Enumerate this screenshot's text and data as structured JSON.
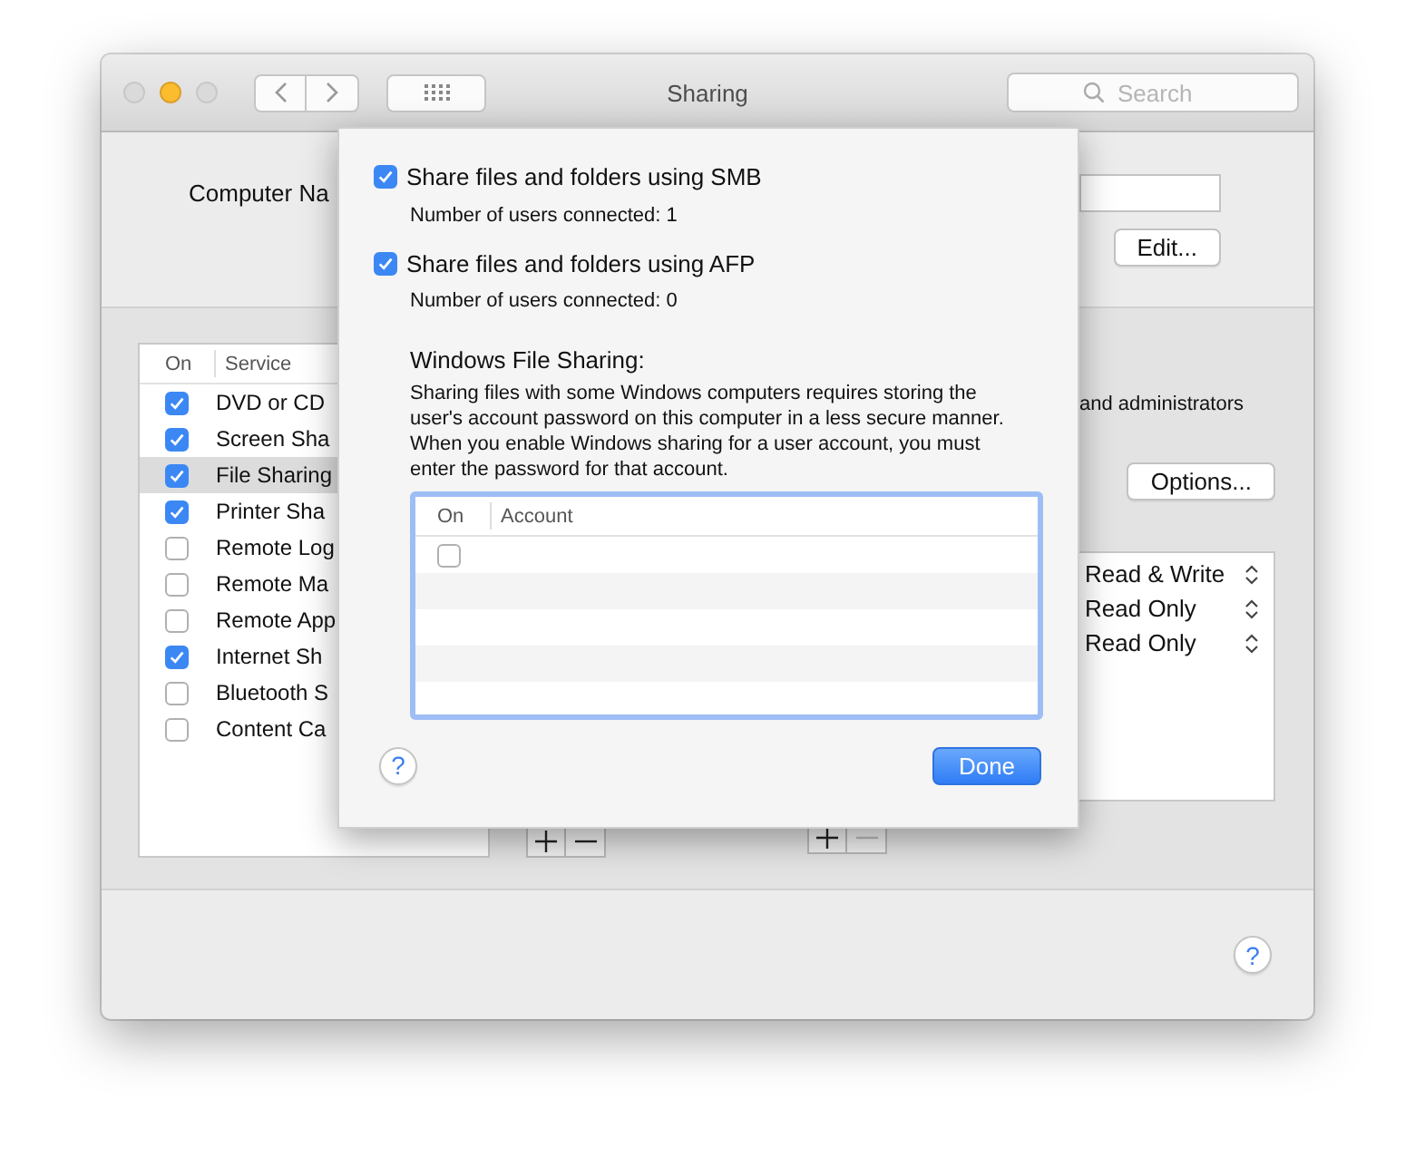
{
  "window": {
    "title": "Sharing"
  },
  "search": {
    "placeholder": "Search"
  },
  "computer_name": {
    "label": "Computer Na"
  },
  "edit_button": "Edit...",
  "services": {
    "columns": [
      "On",
      "Service"
    ],
    "rows": [
      {
        "name": "DVD or CD",
        "checked": true,
        "selected": false
      },
      {
        "name": "Screen Sha",
        "checked": true,
        "selected": false
      },
      {
        "name": "File Sharing",
        "checked": true,
        "selected": true
      },
      {
        "name": "Printer Sha",
        "checked": true,
        "selected": false
      },
      {
        "name": "Remote Log",
        "checked": false,
        "selected": false
      },
      {
        "name": "Remote Ma",
        "checked": false,
        "selected": false
      },
      {
        "name": "Remote App",
        "checked": false,
        "selected": false
      },
      {
        "name": "Internet Sh",
        "checked": true,
        "selected": false
      },
      {
        "name": "Bluetooth S",
        "checked": false,
        "selected": false
      },
      {
        "name": "Content Ca",
        "checked": false,
        "selected": false
      }
    ]
  },
  "shared_folders_controls": {
    "minus_disabled": false
  },
  "access_note": "and administrators",
  "options_button": "Options...",
  "permissions": [
    {
      "value": "Read & Write"
    },
    {
      "value": "Read Only"
    },
    {
      "value": "Read Only"
    }
  ],
  "users_controls": {
    "minus_disabled": true
  },
  "help_button": "?",
  "sheet": {
    "options": [
      {
        "label": "Share files and folders using SMB",
        "checked": true,
        "status": "Number of users connected: 1"
      },
      {
        "label": "Share files and folders using AFP",
        "checked": true,
        "status": "Number of users connected: 0"
      }
    ],
    "windows_heading": "Windows File Sharing:",
    "windows_note": "Sharing files with some Windows computers requires storing the user's account password on this computer in a less secure manner.  When you enable Windows sharing for a user account, you must enter the password for that account.",
    "accounts": {
      "columns": [
        "On",
        "Account"
      ],
      "rows": [
        {
          "checked": false
        }
      ]
    },
    "help_button": "?",
    "done_button": "Done"
  }
}
